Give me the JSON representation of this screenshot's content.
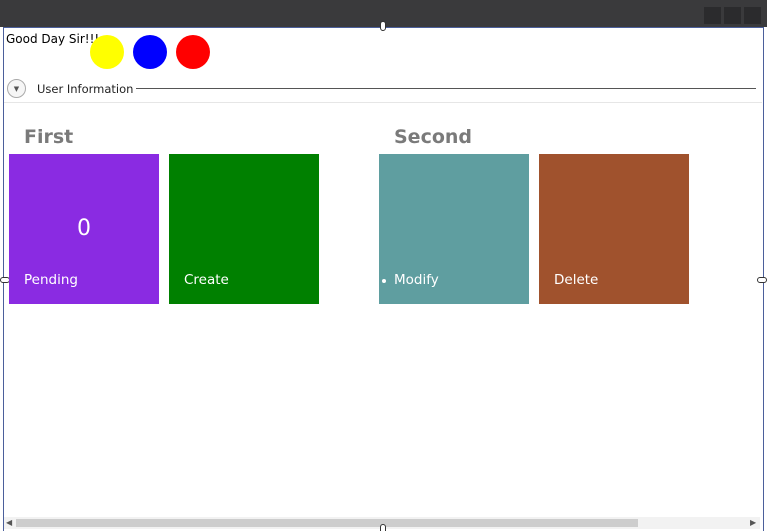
{
  "header": {
    "greeting": "Good Day Sir!!!",
    "indicators": [
      {
        "name": "yellow-indicator",
        "color": "#ffff00"
      },
      {
        "name": "blue-indicator",
        "color": "#0000ff"
      },
      {
        "name": "red-indicator",
        "color": "#ff0000"
      }
    ]
  },
  "expander": {
    "label": "User Information",
    "icon": "chevron-down-icon"
  },
  "groups": [
    {
      "title": "First",
      "tiles": [
        {
          "label": "Pending",
          "count": "0",
          "color": "#8a2be2"
        },
        {
          "label": "Create",
          "color": "#008000"
        }
      ]
    },
    {
      "title": "Second",
      "tiles": [
        {
          "label": "Modify",
          "color": "#5f9ea0"
        },
        {
          "label": "Delete",
          "color": "#a0522d"
        }
      ]
    }
  ]
}
